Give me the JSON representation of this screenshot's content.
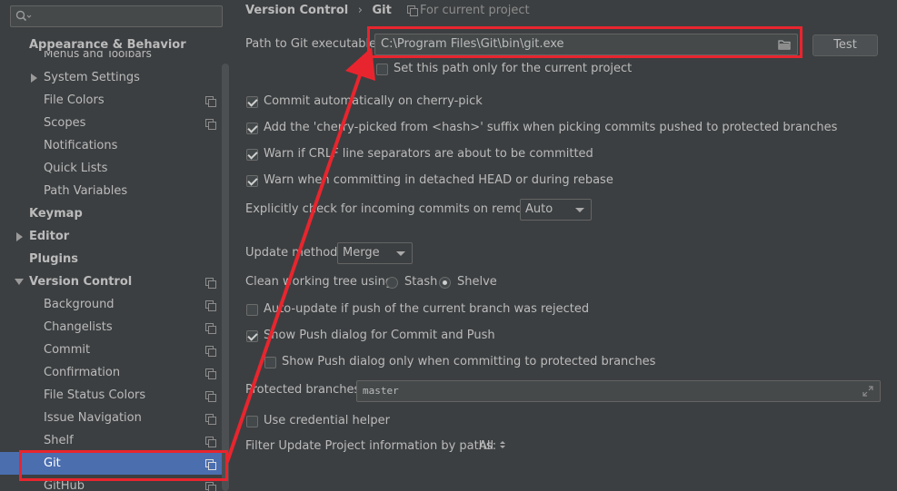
{
  "sidebar": {
    "search_placeholder": "",
    "cut_item": "Menus and Toolbars",
    "items": [
      {
        "label": "Appearance & Behavior"
      },
      {
        "label": "System Settings"
      },
      {
        "label": "File Colors"
      },
      {
        "label": "Scopes"
      },
      {
        "label": "Notifications"
      },
      {
        "label": "Quick Lists"
      },
      {
        "label": "Path Variables"
      },
      {
        "label": "Keymap"
      },
      {
        "label": "Editor"
      },
      {
        "label": "Plugins"
      },
      {
        "label": "Version Control"
      },
      {
        "label": "Background"
      },
      {
        "label": "Changelists"
      },
      {
        "label": "Commit"
      },
      {
        "label": "Confirmation"
      },
      {
        "label": "File Status Colors"
      },
      {
        "label": "Issue Navigation"
      },
      {
        "label": "Shelf"
      },
      {
        "label": "Git"
      },
      {
        "label": "GitHub"
      }
    ]
  },
  "header": {
    "crumb1": "Version Control",
    "separator": "›",
    "crumb2": "Git",
    "scope": "For current project"
  },
  "git": {
    "path_label": "Path to Git executable:",
    "path_value": "C:\\Program Files\\Git\\bin\\git.exe",
    "test_button": "Test",
    "current_project_only": "Set this path only for the current project",
    "commit_cherry_pick": "Commit automatically on cherry-pick",
    "cherry_suffix": "Add the 'cherry-picked from <hash>' suffix when picking commits pushed to protected branches",
    "warn_crlf": "Warn if CRLF line separators are about to be committed",
    "warn_detached": "Warn when committing in detached HEAD or during rebase",
    "incoming_label": "Explicitly check for incoming commits on remotes:",
    "incoming_value": "Auto",
    "update_label": "Update method:",
    "update_value": "Merge",
    "clean_label": "Clean working tree using:",
    "stash": "Stash",
    "shelve": "Shelve",
    "auto_update": "Auto-update if push of the current branch was rejected",
    "show_push": "Show Push dialog for Commit and Push",
    "show_push_protected": "Show Push dialog only when committing to protected branches",
    "protected_label": "Protected branches:",
    "protected_value": "master",
    "credential_helper": "Use credential helper",
    "filter_label": "Filter Update Project information by paths:",
    "filter_value": "All"
  },
  "colors": {
    "selection": "#4b6eaf",
    "annotation": "#e8252e",
    "background": "#3c3f41"
  }
}
